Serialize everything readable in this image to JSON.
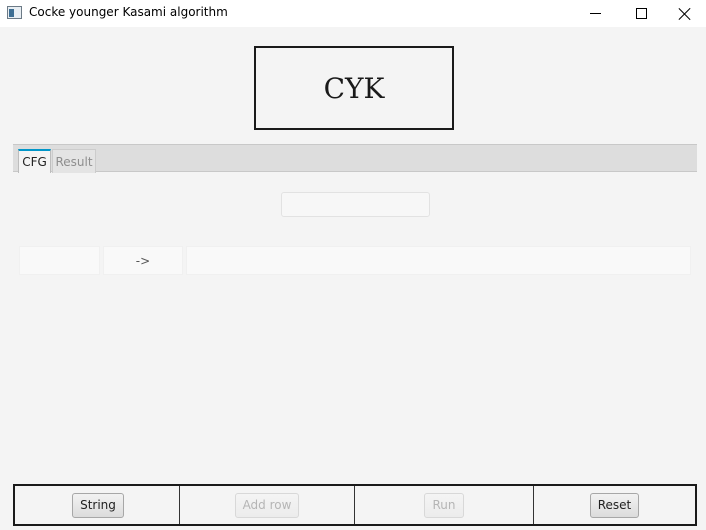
{
  "window": {
    "title": "Cocke younger Kasami algorithm"
  },
  "header": {
    "title": "CYK"
  },
  "tabs": [
    {
      "label": "CFG",
      "active": true
    },
    {
      "label": "Result",
      "active": false
    }
  ],
  "cfg": {
    "string_input_value": "",
    "rules": [
      {
        "left": "",
        "arrow": "->",
        "right": ""
      }
    ]
  },
  "actions": {
    "string_label": "String",
    "add_row_label": "Add row",
    "run_label": "Run",
    "reset_label": "Reset"
  },
  "colors": {
    "accent": "#0096c9",
    "background": "#f4f4f4"
  }
}
